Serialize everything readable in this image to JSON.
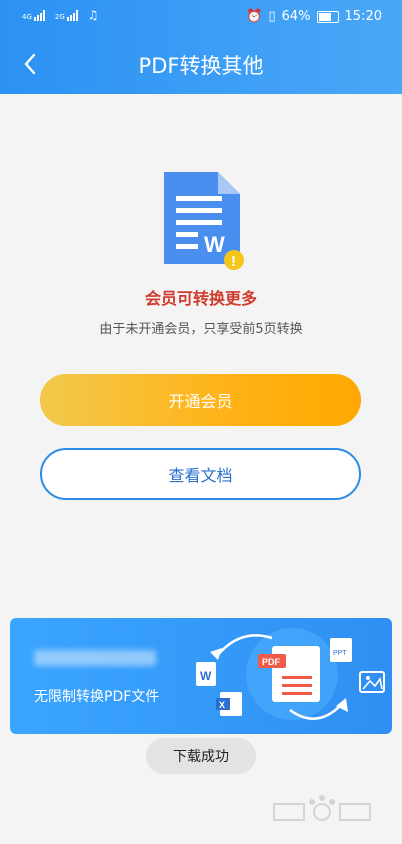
{
  "status_bar": {
    "left_labels": [
      "4G",
      "2G"
    ],
    "battery": "64%",
    "time": "15:20"
  },
  "header": {
    "title": "PDF转换其他"
  },
  "document_icon": {
    "glyph": "W",
    "badge": "!"
  },
  "notice": {
    "title": "会员可转换更多",
    "subtitle": "由于未开通会员，只享受前5页转换"
  },
  "buttons": {
    "vip": "开通会员",
    "view_doc": "查看文档"
  },
  "banner": {
    "caption": "无限制转换PDF文件",
    "pdf_label": "PDF",
    "ppt_label": "PPT",
    "word_label": "W",
    "excel_label": "X"
  },
  "toast": {
    "text": "下载成功"
  },
  "colors": {
    "header": "#2b92f3",
    "accent": "#2a8be8",
    "warning_text": "#d03b2d",
    "vip_gradient_end": "#ffa800"
  }
}
